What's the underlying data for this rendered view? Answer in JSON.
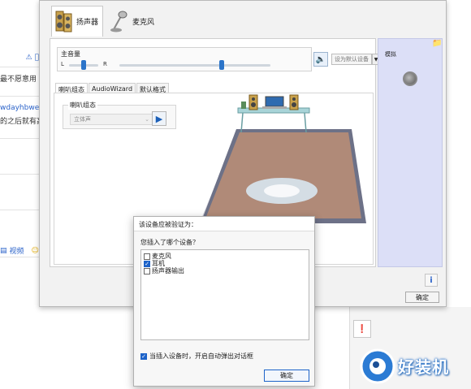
{
  "background": {
    "strip_texts": [
      "最不愿意用",
      "wdayhbwei",
      "的之后就有高"
    ],
    "video_label": "视频",
    "warn_icon": "warning-icon"
  },
  "main_window": {
    "device_tabs": [
      {
        "label": "扬声器",
        "icon": "speaker-icon",
        "active": true
      },
      {
        "label": "麦克风",
        "icon": "microphone-icon",
        "active": false
      }
    ],
    "volume": {
      "title": "主音量",
      "left_label": "L",
      "right_label": "R",
      "balance_position": 0.5,
      "volume_level": 0.68,
      "set_default_label": "设为默认设备"
    },
    "sub_tabs": [
      "喇叭组态",
      "AudioWizard",
      "默认格式"
    ],
    "speaker_config": {
      "group_title": "喇叭组态",
      "selected": "立体声"
    },
    "side_panel": {
      "title": "模拟"
    },
    "ok_label": "确定"
  },
  "dialog": {
    "title": "该设备应被验证为：",
    "question": "您插入了哪个设备？",
    "options": [
      {
        "label": "麦克风",
        "checked": false
      },
      {
        "label": "耳机",
        "checked": true
      },
      {
        "label": "扬声器输出",
        "checked": false
      }
    ],
    "auto_popup_label": "当插入设备时，开启自动弹出对话框",
    "auto_popup_checked": true,
    "ok_label": "确定"
  },
  "watermark": {
    "text": "好装机"
  },
  "colors": {
    "accent": "#1d63c9",
    "floor": "#b08a78",
    "side_panel": "#dcdff7"
  }
}
